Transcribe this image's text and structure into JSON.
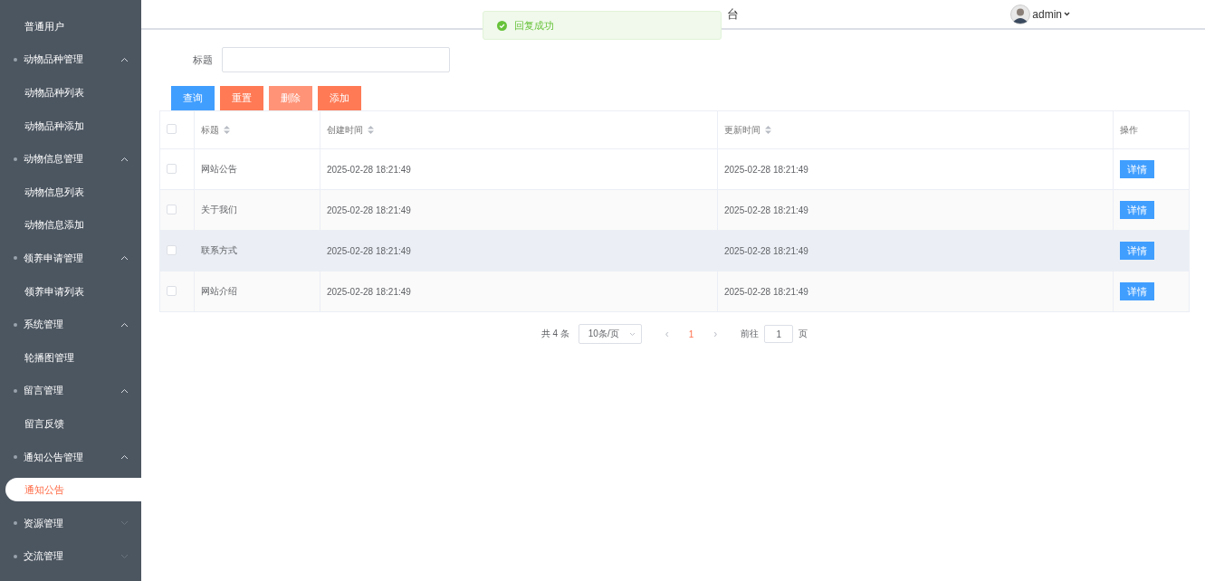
{
  "sidebar": {
    "items": [
      {
        "kind": "item",
        "label": "普通用户",
        "selected": false
      },
      {
        "kind": "group",
        "label": "动物品种管理",
        "expanded": true,
        "children": [
          {
            "kind": "item",
            "label": "动物品种列表",
            "selected": false
          },
          {
            "kind": "item",
            "label": "动物品种添加",
            "selected": false
          }
        ]
      },
      {
        "kind": "group",
        "label": "动物信息管理",
        "expanded": true,
        "children": [
          {
            "kind": "item",
            "label": "动物信息列表",
            "selected": false
          },
          {
            "kind": "item",
            "label": "动物信息添加",
            "selected": false
          }
        ]
      },
      {
        "kind": "group",
        "label": "领养申请管理",
        "expanded": true,
        "children": [
          {
            "kind": "item",
            "label": "领养申请列表",
            "selected": false
          }
        ]
      },
      {
        "kind": "group",
        "label": "系统管理",
        "expanded": true,
        "children": [
          {
            "kind": "item",
            "label": "轮播图管理",
            "selected": false
          }
        ]
      },
      {
        "kind": "group",
        "label": "留言管理",
        "expanded": true,
        "children": [
          {
            "kind": "item",
            "label": "留言反馈",
            "selected": false
          }
        ]
      },
      {
        "kind": "group",
        "label": "通知公告管理",
        "expanded": true,
        "children": [
          {
            "kind": "item",
            "label": "通知公告",
            "selected": true
          }
        ]
      },
      {
        "kind": "group",
        "label": "资源管理",
        "expanded": false
      },
      {
        "kind": "group",
        "label": "交流管理",
        "expanded": false
      }
    ]
  },
  "header": {
    "title": "台",
    "user": "admin"
  },
  "toast": {
    "message": "回复成功"
  },
  "search": {
    "label": "标题"
  },
  "buttons": [
    {
      "label": "查询",
      "kind": "primary"
    },
    {
      "label": "重置",
      "kind": "danger"
    },
    {
      "label": "删除",
      "kind": "danger-light"
    },
    {
      "label": "添加",
      "kind": "danger"
    }
  ],
  "table": {
    "all_checked": false,
    "columns": [
      "标题",
      "创建时间",
      "更新时间",
      "操作"
    ],
    "rows": [
      {
        "title": "网站公告",
        "created": "2025-02-28 18:21:49",
        "updated": "2025-02-28 18:21:49",
        "action": "详情",
        "checked": false,
        "hovered": false
      },
      {
        "title": "关于我们",
        "created": "2025-02-28 18:21:49",
        "updated": "2025-02-28 18:21:49",
        "action": "详情",
        "checked": false,
        "hovered": false
      },
      {
        "title": "联系方式",
        "created": "2025-02-28 18:21:49",
        "updated": "2025-02-28 18:21:49",
        "action": "详情",
        "checked": false,
        "hovered": true
      },
      {
        "title": "网站介绍",
        "created": "2025-02-28 18:21:49",
        "updated": "2025-02-28 18:21:49",
        "action": "详情",
        "checked": false,
        "hovered": false
      }
    ]
  },
  "pagination": {
    "total": "共 4 条",
    "page_size": "10条/页",
    "prev": "‹",
    "pages": [
      {
        "label": "1",
        "selected": true
      }
    ],
    "next": "›",
    "goto_label": "前往",
    "goto_value": "1",
    "goto_suffix": "页"
  }
}
